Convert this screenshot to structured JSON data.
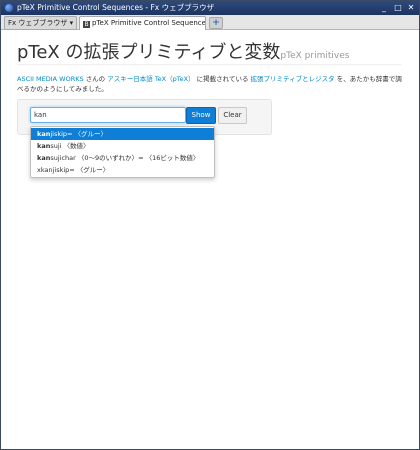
{
  "window": {
    "title": "pTeX Primitive Control Sequences - Fx ウェブブラウザ",
    "controls": [
      "_",
      "□",
      "✕"
    ]
  },
  "browser": {
    "menu_button": "Fx ウェブブラウザ ▾",
    "tab_title": "pTeX Primitive Control Sequences",
    "new_tab": "+"
  },
  "page": {
    "heading": "pTeX の拡張プリミティブと変数",
    "heading_small": "pTeX primitives",
    "intro": {
      "link1": "ASCII MEDIA WORKS",
      "text1": " さんの ",
      "link2": "アスキー日本語 TeX（pTeX）",
      "text2": " に掲載されている ",
      "link3": "拡張プリミティブとレジスタ",
      "text3": " を、あたかも辞書で調べるかのようにしてみました。"
    }
  },
  "search": {
    "value": "kan",
    "show_label": "Show",
    "clear_label": "Clear"
  },
  "suggestions": [
    {
      "bold": "kan",
      "rest": "jiskip= 〈グルー〉"
    },
    {
      "bold": "kan",
      "rest": "suji 〈数値〉"
    },
    {
      "bold": "kan",
      "rest": "sujichar 〈0～9のいずれか〉= 〈16ビット数値〉"
    },
    {
      "bold": "",
      "rest": "xkanjiskip= 〈グルー〉"
    }
  ],
  "colors": {
    "accent": "#0e7ed6",
    "link": "#0088cc",
    "titlebar": "#2e4a7d"
  }
}
